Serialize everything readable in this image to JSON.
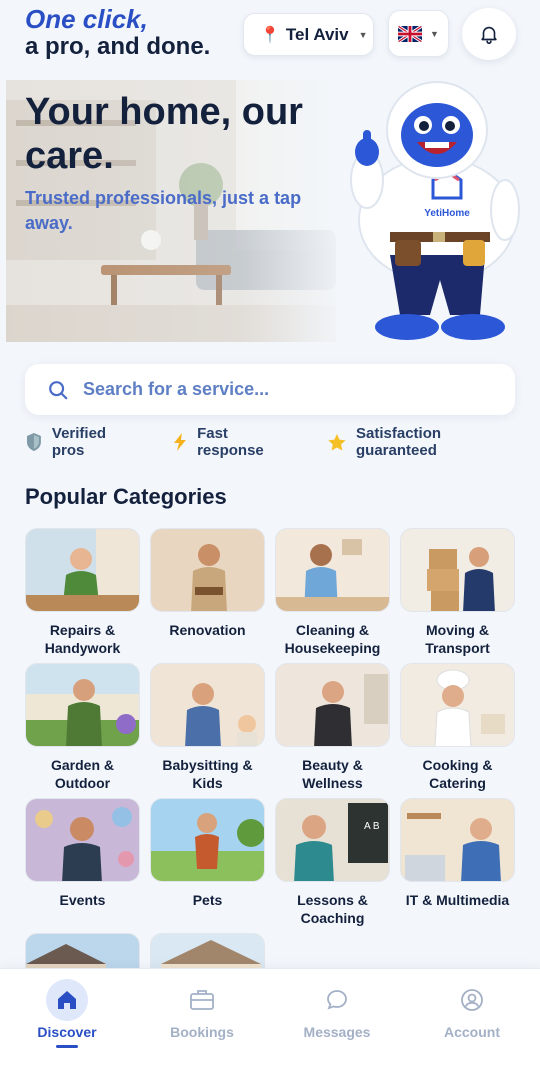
{
  "header": {
    "tagline_line1": "One click,",
    "tagline_line2": "a pro, and done.",
    "location": "Tel Aviv",
    "language_flag": "uk-flag-icon"
  },
  "hero": {
    "title": "Your home, our care.",
    "subtitle": "Trusted professionals, just a tap away.",
    "mascot_shirt_text": "YetiHome"
  },
  "search": {
    "placeholder": "Search for a service..."
  },
  "trust_badges": [
    {
      "label": "Verified pros",
      "icon": "shield-icon"
    },
    {
      "label": "Fast response",
      "icon": "lightning-icon"
    },
    {
      "label": "Satisfaction guaranteed",
      "icon": "star-icon"
    }
  ],
  "categories_title": "Popular Categories",
  "categories": [
    {
      "label": "Repairs &\nHandywork"
    },
    {
      "label": "Renovation"
    },
    {
      "label": "Cleaning &\nHousekeeping"
    },
    {
      "label": "Moving &\nTransport"
    },
    {
      "label": "Garden &\nOutdoor"
    },
    {
      "label": "Babysitting &\nKids"
    },
    {
      "label": "Beauty &\nWellness"
    },
    {
      "label": "Cooking &\nCatering"
    },
    {
      "label": "Events"
    },
    {
      "label": "Pets"
    },
    {
      "label": "Lessons &\nCoaching"
    },
    {
      "label": "IT & Multimedia"
    }
  ],
  "nav": {
    "items": [
      {
        "label": "Discover",
        "icon": "home-icon",
        "active": true
      },
      {
        "label": "Bookings",
        "icon": "briefcase-icon",
        "active": false
      },
      {
        "label": "Messages",
        "icon": "chat-bubble-icon",
        "active": false
      },
      {
        "label": "Account",
        "icon": "user-circle-icon",
        "active": false
      }
    ]
  },
  "colors": {
    "accent": "#2a4fc4",
    "text_dark": "#14213d",
    "subtitle_blue": "#4a6cc8",
    "background": "#f3f7fc",
    "nav_inactive": "#a3b0c6"
  }
}
